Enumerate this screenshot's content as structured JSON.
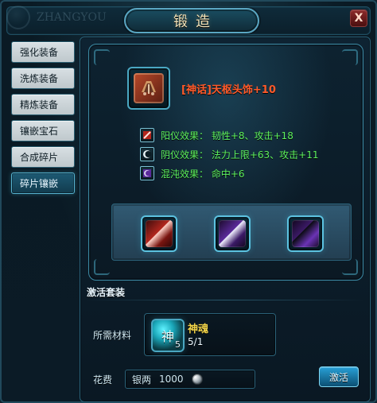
{
  "window": {
    "title": "锻造",
    "close_label": "X",
    "watermark_text": "ZHANGYOU"
  },
  "sidebar": {
    "items": [
      {
        "label": "强化装备"
      },
      {
        "label": "洗炼装备"
      },
      {
        "label": "精炼装备"
      },
      {
        "label": "镶嵌宝石"
      },
      {
        "label": "合成碎片"
      },
      {
        "label": "碎片镶嵌"
      }
    ],
    "active_index": 5
  },
  "item": {
    "name": "[神话]天枢头饰+10",
    "icon": "helmet-item-icon"
  },
  "effects": [
    {
      "icon": "yang-effect-icon",
      "text": "阳仪效果： 韧性+8、攻击+18"
    },
    {
      "icon": "yin-effect-icon",
      "text": "阴仪效果： 法力上限+63、攻击+11"
    },
    {
      "icon": "chaos-effect-icon",
      "text": "混沌效果： 命中+6"
    }
  ],
  "gem_slots": [
    {
      "icon": "red-fragment-icon"
    },
    {
      "icon": "purple-fragment-icon"
    },
    {
      "icon": "purple-fragment-icon"
    }
  ],
  "activation": {
    "section_title": "激活套装",
    "required_label": "所需材料",
    "material": {
      "name": "神魂",
      "count_badge": "5",
      "progress": "5/1",
      "icon": "soul-material-icon",
      "glyph": "神"
    },
    "cost_label": "花费",
    "currency_label": "银两",
    "cost_value": "1000",
    "coin_icon": "silver-coin-icon",
    "activate_label": "激活"
  },
  "colors": {
    "accent": "#4aa7c2",
    "effect_green": "#5df05d",
    "item_orange": "#ff5a2a",
    "material_yellow": "#f3d54a"
  }
}
